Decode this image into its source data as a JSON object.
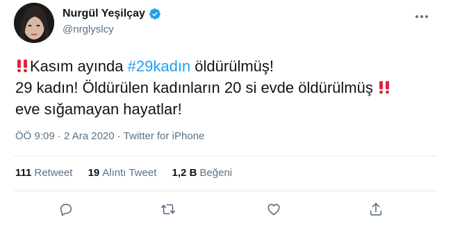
{
  "user": {
    "display_name": "Nurgül Yeşilçay",
    "handle": "@nrglyslcy",
    "verified": true
  },
  "tweet": {
    "line1_before": "Kasım ayında ",
    "line1_hashtag": "#29kadın",
    "line1_after": " öldürülmüş!",
    "line2": "29 kadın! Öldürülen kadınların 20 si evde öldürülmüş ",
    "line3": "eve sığamayan hayatlar!",
    "emoji": "double-exclamation-icon"
  },
  "meta": {
    "time": "ÖÖ 9:09",
    "separator1": " · ",
    "date": "2 Ara 2020",
    "separator2": " · ",
    "source": "Twitter for iPhone"
  },
  "stats": {
    "retweets_count": "111",
    "retweets_label": "Retweet",
    "quotes_count": "19",
    "quotes_label": "Alıntı Tweet",
    "likes_count": "1,2 B",
    "likes_label": "Beğeni"
  },
  "colors": {
    "hashtag": "#1da1f2",
    "verified": "#1da1f2",
    "muted": "#5b7083",
    "emoji_red": "#e0243a"
  },
  "icons": {
    "more": "more-icon",
    "reply": "reply-icon",
    "retweet": "retweet-icon",
    "like": "heart-icon",
    "share": "share-icon"
  }
}
